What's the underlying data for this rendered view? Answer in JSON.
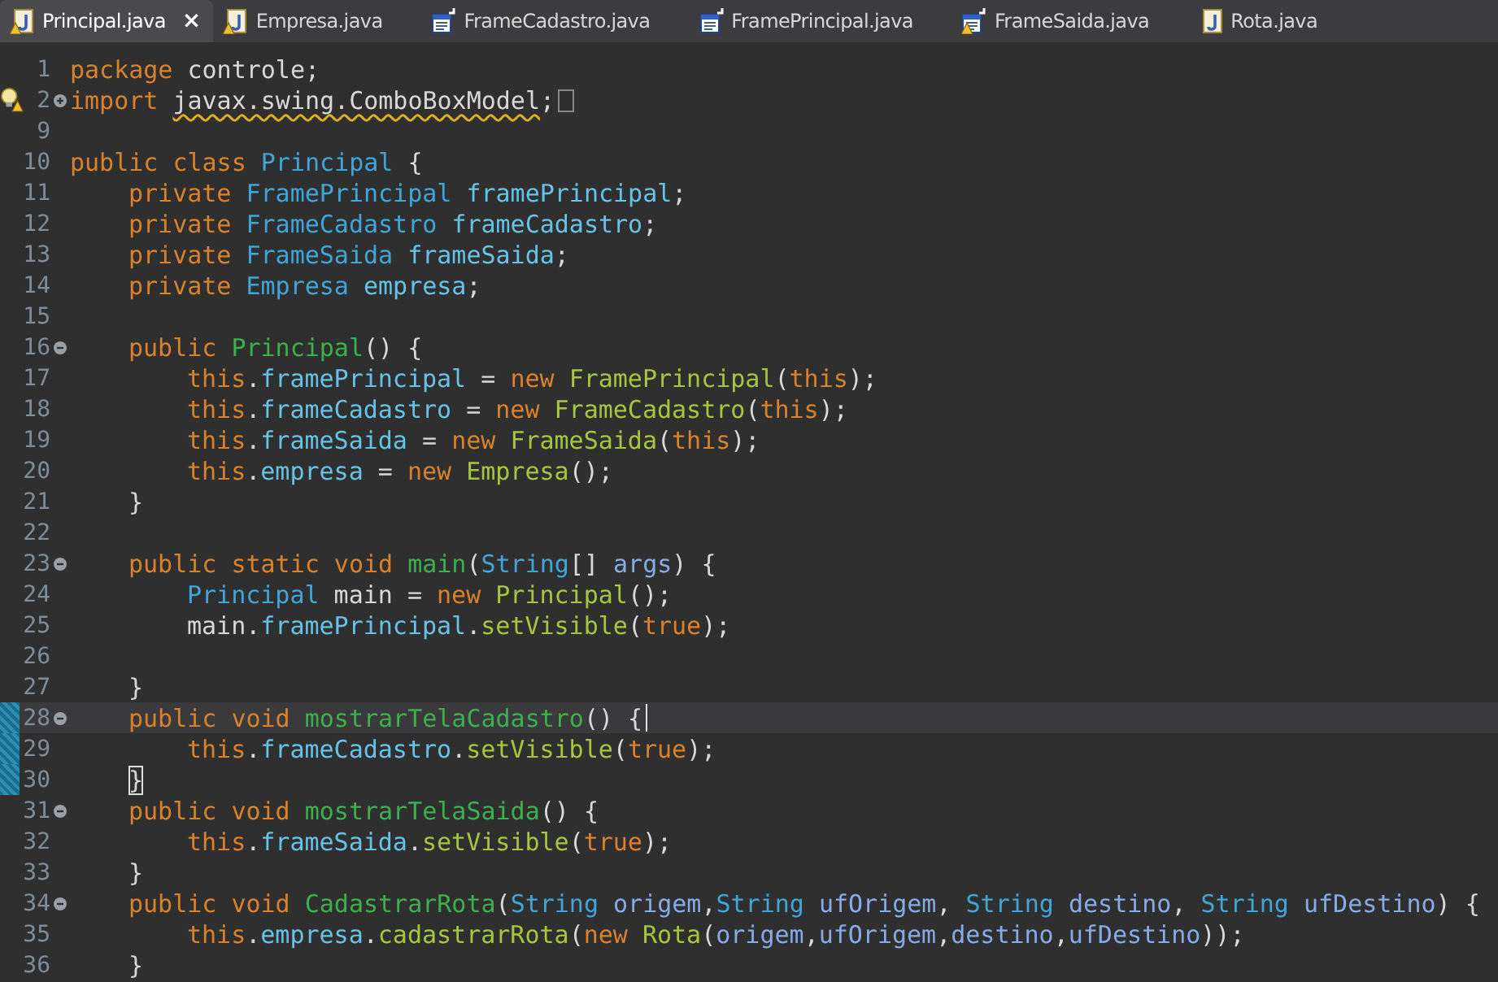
{
  "tabs": [
    {
      "label": "Principal.java",
      "kind": "class",
      "warning": true,
      "selected": true,
      "close": "×"
    },
    {
      "label": "Empresa.java",
      "kind": "class",
      "warning": true,
      "selected": false
    },
    {
      "label": "FrameCadastro.java",
      "kind": "form",
      "warning": false,
      "selected": false
    },
    {
      "label": "FramePrincipal.java",
      "kind": "form",
      "warning": false,
      "selected": false
    },
    {
      "label": "FrameSaida.java",
      "kind": "form",
      "warning": true,
      "selected": false
    },
    {
      "label": "Rota.java",
      "kind": "class",
      "warning": false,
      "selected": false
    }
  ],
  "lines": [
    {
      "n": "1",
      "warning": false,
      "current": false,
      "range": false,
      "tokens": [
        {
          "kind": "keyword",
          "text": "package"
        },
        {
          "kind": "code",
          "text": " controle;"
        }
      ]
    },
    {
      "n": "2",
      "expanded": false,
      "warning": true,
      "current": false,
      "range": false,
      "tokens": [
        {
          "kind": "keyword",
          "text": "import "
        },
        {
          "kind": "warned",
          "text": "javax.swing.ComboBoxModel"
        },
        {
          "kind": "code",
          "text": ";"
        }
      ]
    },
    {
      "n": "9",
      "warning": false,
      "current": false,
      "range": false
    },
    {
      "n": "10",
      "warning": false,
      "current": false,
      "range": false,
      "tokens": [
        {
          "kind": "keyword",
          "text": "public class "
        },
        {
          "kind": "type",
          "text": "Principal"
        },
        {
          "kind": "code",
          "text": " {"
        }
      ],
      "children": [
        {
          "n": "11",
          "warning": false,
          "current": false,
          "range": false,
          "tokens": [
            {
              "kind": "keyword",
              "text": "private "
            },
            {
              "kind": "type",
              "text": "FramePrincipal "
            },
            {
              "kind": "field",
              "text": "framePrincipal"
            },
            {
              "kind": "code",
              "text": ";"
            }
          ]
        },
        {
          "n": "12",
          "warning": false,
          "current": false,
          "range": false,
          "tokens": [
            {
              "kind": "keyword",
              "text": "private "
            },
            {
              "kind": "type",
              "text": "FrameCadastro "
            },
            {
              "kind": "field",
              "text": "frameCadastro"
            },
            {
              "kind": "code",
              "text": ";"
            }
          ]
        },
        {
          "n": "13",
          "warning": false,
          "current": false,
          "range": false,
          "tokens": [
            {
              "kind": "keyword",
              "text": "private "
            },
            {
              "kind": "type",
              "text": "FrameSaida "
            },
            {
              "kind": "field",
              "text": "frameSaida"
            },
            {
              "kind": "code",
              "text": ";"
            }
          ]
        },
        {
          "n": "14",
          "warning": false,
          "current": false,
          "range": false,
          "tokens": [
            {
              "kind": "keyword",
              "text": "private "
            },
            {
              "kind": "type",
              "text": "Empresa "
            },
            {
              "kind": "field",
              "text": "empresa"
            },
            {
              "kind": "code",
              "text": ";"
            }
          ]
        },
        {
          "n": "15",
          "warning": false,
          "current": false,
          "range": false
        },
        {
          "n": "16",
          "expanded": true,
          "warning": false,
          "current": false,
          "range": false,
          "tokens": [
            {
              "kind": "keyword",
              "text": "public "
            },
            {
              "kind": "method",
              "text": "Principal"
            },
            {
              "kind": "code",
              "text": "() {"
            }
          ],
          "children": [
            {
              "n": "17",
              "warning": false,
              "current": false,
              "range": false,
              "tokens": [
                {
                  "kind": "keyword",
                  "text": "this"
                },
                {
                  "kind": "code",
                  "text": "."
                },
                {
                  "kind": "field",
                  "text": "framePrincipal"
                },
                {
                  "kind": "code",
                  "text": " = "
                },
                {
                  "kind": "keyword",
                  "text": "new "
                },
                {
                  "kind": "call",
                  "text": "FramePrincipal"
                },
                {
                  "kind": "code",
                  "text": "("
                },
                {
                  "kind": "keyword",
                  "text": "this"
                },
                {
                  "kind": "code",
                  "text": ");"
                }
              ]
            },
            {
              "n": "18",
              "warning": false,
              "current": false,
              "range": false,
              "tokens": [
                {
                  "kind": "keyword",
                  "text": "this"
                },
                {
                  "kind": "code",
                  "text": "."
                },
                {
                  "kind": "field",
                  "text": "frameCadastro"
                },
                {
                  "kind": "code",
                  "text": " = "
                },
                {
                  "kind": "keyword",
                  "text": "new "
                },
                {
                  "kind": "call",
                  "text": "FrameCadastro"
                },
                {
                  "kind": "code",
                  "text": "("
                },
                {
                  "kind": "keyword",
                  "text": "this"
                },
                {
                  "kind": "code",
                  "text": ");"
                }
              ]
            },
            {
              "n": "19",
              "warning": false,
              "current": false,
              "range": false,
              "tokens": [
                {
                  "kind": "keyword",
                  "text": "this"
                },
                {
                  "kind": "code",
                  "text": "."
                },
                {
                  "kind": "field",
                  "text": "frameSaida"
                },
                {
                  "kind": "code",
                  "text": " = "
                },
                {
                  "kind": "keyword",
                  "text": "new "
                },
                {
                  "kind": "call",
                  "text": "FrameSaida"
                },
                {
                  "kind": "code",
                  "text": "("
                },
                {
                  "kind": "keyword",
                  "text": "this"
                },
                {
                  "kind": "code",
                  "text": ");"
                }
              ]
            },
            {
              "n": "20",
              "warning": false,
              "current": false,
              "range": false,
              "tokens": [
                {
                  "kind": "keyword",
                  "text": "this"
                },
                {
                  "kind": "code",
                  "text": "."
                },
                {
                  "kind": "field",
                  "text": "empresa"
                },
                {
                  "kind": "code",
                  "text": " = "
                },
                {
                  "kind": "keyword",
                  "text": "new "
                },
                {
                  "kind": "call",
                  "text": "Empresa"
                },
                {
                  "kind": "code",
                  "text": "();"
                }
              ]
            }
          ]
        },
        {
          "n": "21",
          "warning": false,
          "current": false,
          "range": false,
          "tokens": [
            {
              "kind": "code",
              "text": "}"
            }
          ]
        },
        {
          "n": "22",
          "warning": false,
          "current": false,
          "range": false
        },
        {
          "n": "23",
          "expanded": true,
          "warning": false,
          "current": false,
          "range": false,
          "tokens": [
            {
              "kind": "keyword",
              "text": "public static void "
            },
            {
              "kind": "method",
              "text": "main"
            },
            {
              "kind": "code",
              "text": "("
            },
            {
              "kind": "type",
              "text": "String"
            },
            {
              "kind": "code",
              "text": "[] "
            },
            {
              "kind": "param",
              "text": "args"
            },
            {
              "kind": "code",
              "text": ") {"
            }
          ],
          "children": [
            {
              "n": "24",
              "warning": false,
              "current": false,
              "range": false,
              "tokens": [
                {
                  "kind": "type",
                  "text": "Principal"
                },
                {
                  "kind": "code",
                  "text": " main = "
                },
                {
                  "kind": "keyword",
                  "text": "new "
                },
                {
                  "kind": "call",
                  "text": "Principal"
                },
                {
                  "kind": "code",
                  "text": "();"
                }
              ]
            },
            {
              "n": "25",
              "warning": false,
              "current": false,
              "range": false,
              "tokens": [
                {
                  "kind": "code",
                  "text": "main."
                },
                {
                  "kind": "field",
                  "text": "framePrincipal"
                },
                {
                  "kind": "code",
                  "text": "."
                },
                {
                  "kind": "call",
                  "text": "setVisible"
                },
                {
                  "kind": "code",
                  "text": "("
                },
                {
                  "kind": "keyword",
                  "text": "true"
                },
                {
                  "kind": "code",
                  "text": ");"
                }
              ]
            },
            {
              "n": "26",
              "warning": false,
              "current": false,
              "range": false
            }
          ]
        },
        {
          "n": "27",
          "warning": false,
          "current": false,
          "range": false,
          "tokens": [
            {
              "kind": "code",
              "text": "}"
            }
          ]
        },
        {
          "n": "28",
          "expanded": true,
          "warning": false,
          "current": true,
          "range": true,
          "tokens": [
            {
              "kind": "keyword",
              "text": "public void "
            },
            {
              "kind": "method",
              "text": "mostrarTelaCadastro"
            },
            {
              "kind": "code",
              "text": "() {"
            }
          ],
          "children": [
            {
              "n": "29",
              "warning": false,
              "current": false,
              "range": true,
              "tokens": [
                {
                  "kind": "keyword",
                  "text": "this"
                },
                {
                  "kind": "code",
                  "text": "."
                },
                {
                  "kind": "field",
                  "text": "frameCadastro"
                },
                {
                  "kind": "code",
                  "text": "."
                },
                {
                  "kind": "call",
                  "text": "setVisible"
                },
                {
                  "kind": "code",
                  "text": "("
                },
                {
                  "kind": "keyword",
                  "text": "true"
                },
                {
                  "kind": "code",
                  "text": ");"
                }
              ]
            }
          ]
        },
        {
          "n": "30",
          "warning": false,
          "current": false,
          "range": true,
          "tokens": [
            {
              "kind": "bracket",
              "text": "}"
            }
          ]
        },
        {
          "n": "31",
          "expanded": true,
          "warning": false,
          "current": false,
          "range": false,
          "tokens": [
            {
              "kind": "keyword",
              "text": "public void "
            },
            {
              "kind": "method",
              "text": "mostrarTelaSaida"
            },
            {
              "kind": "code",
              "text": "() {"
            }
          ],
          "children": [
            {
              "n": "32",
              "warning": false,
              "current": false,
              "range": false,
              "tokens": [
                {
                  "kind": "keyword",
                  "text": "this"
                },
                {
                  "kind": "code",
                  "text": "."
                },
                {
                  "kind": "field",
                  "text": "frameSaida"
                },
                {
                  "kind": "code",
                  "text": "."
                },
                {
                  "kind": "call",
                  "text": "setVisible"
                },
                {
                  "kind": "code",
                  "text": "("
                },
                {
                  "kind": "keyword",
                  "text": "true"
                },
                {
                  "kind": "code",
                  "text": ");"
                }
              ]
            }
          ]
        },
        {
          "n": "33",
          "warning": false,
          "current": false,
          "range": false,
          "tokens": [
            {
              "kind": "code",
              "text": "}"
            }
          ]
        },
        {
          "n": "34",
          "expanded": true,
          "warning": false,
          "current": false,
          "range": false,
          "tokens": [
            {
              "kind": "keyword",
              "text": "public void "
            },
            {
              "kind": "method",
              "text": "CadastrarRota"
            },
            {
              "kind": "code",
              "text": "("
            },
            {
              "kind": "type",
              "text": "String "
            },
            {
              "kind": "param",
              "text": "origem"
            },
            {
              "kind": "code",
              "text": ","
            },
            {
              "kind": "type",
              "text": "String "
            },
            {
              "kind": "param",
              "text": "ufOrigem"
            },
            {
              "kind": "code",
              "text": ", "
            },
            {
              "kind": "type",
              "text": "String "
            },
            {
              "kind": "param",
              "text": "destino"
            },
            {
              "kind": "code",
              "text": ", "
            },
            {
              "kind": "type",
              "text": "String "
            },
            {
              "kind": "param",
              "text": "ufDestino"
            },
            {
              "kind": "code",
              "text": ") {"
            }
          ],
          "children": [
            {
              "n": "35",
              "warning": false,
              "current": false,
              "range": false,
              "tokens": [
                {
                  "kind": "keyword",
                  "text": "this"
                },
                {
                  "kind": "code",
                  "text": "."
                },
                {
                  "kind": "field",
                  "text": "empresa"
                },
                {
                  "kind": "code",
                  "text": "."
                },
                {
                  "kind": "call",
                  "text": "cadastrarRota"
                },
                {
                  "kind": "code",
                  "text": "("
                },
                {
                  "kind": "keyword",
                  "text": "new "
                },
                {
                  "kind": "call",
                  "text": "Rota"
                },
                {
                  "kind": "code",
                  "text": "("
                },
                {
                  "kind": "param",
                  "text": "origem"
                },
                {
                  "kind": "code",
                  "text": ","
                },
                {
                  "kind": "param",
                  "text": "ufOrigem"
                },
                {
                  "kind": "code",
                  "text": ","
                },
                {
                  "kind": "param",
                  "text": "destino"
                },
                {
                  "kind": "code",
                  "text": ","
                },
                {
                  "kind": "param",
                  "text": "ufDestino"
                },
                {
                  "kind": "code",
                  "text": "));"
                }
              ]
            }
          ]
        },
        {
          "n": "36",
          "warning": false,
          "current": false,
          "range": false,
          "tokens": [
            {
              "kind": "code",
              "text": "}"
            }
          ]
        }
      ]
    }
  ]
}
